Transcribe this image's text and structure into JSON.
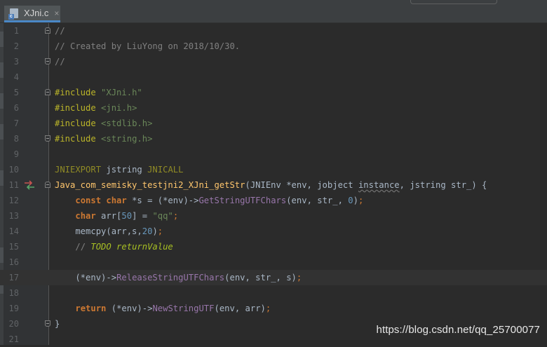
{
  "tab": {
    "filename": "XJni.c",
    "icon_letter": "c",
    "close_glyph": "×"
  },
  "lines": [
    {
      "num": "1",
      "tokens": [
        {
          "t": "cm",
          "v": "//"
        }
      ]
    },
    {
      "num": "2",
      "tokens": [
        {
          "t": "cm",
          "v": "// Created by LiuYong on 2018/10/30."
        }
      ]
    },
    {
      "num": "3",
      "tokens": [
        {
          "t": "cm",
          "v": "//"
        }
      ]
    },
    {
      "num": "4",
      "tokens": []
    },
    {
      "num": "5",
      "tokens": [
        {
          "t": "pp",
          "v": "#include "
        },
        {
          "t": "st",
          "v": "\"XJni.h\""
        }
      ]
    },
    {
      "num": "6",
      "tokens": [
        {
          "t": "pp",
          "v": "#include "
        },
        {
          "t": "st",
          "v": "<jni.h>"
        }
      ]
    },
    {
      "num": "7",
      "tokens": [
        {
          "t": "pp",
          "v": "#include "
        },
        {
          "t": "st",
          "v": "<stdlib.h>"
        }
      ]
    },
    {
      "num": "8",
      "tokens": [
        {
          "t": "pp",
          "v": "#include "
        },
        {
          "t": "st",
          "v": "<string.h>"
        }
      ]
    },
    {
      "num": "9",
      "tokens": []
    },
    {
      "num": "10",
      "tokens": [
        {
          "t": "mc",
          "v": "JNIEXPORT"
        },
        {
          "t": "pu",
          "v": " jstring "
        },
        {
          "t": "mc",
          "v": "JNICALL"
        }
      ]
    },
    {
      "num": "11",
      "tokens": [
        {
          "t": "fn",
          "v": "Java_com_semisky_testjni2_XJni_getStr"
        },
        {
          "t": "pu",
          "v": "(JNIEnv *env, jobject "
        },
        {
          "t": "un",
          "v": "instance"
        },
        {
          "t": "pu",
          "v": ", jstring str_) {"
        }
      ]
    },
    {
      "num": "12",
      "tokens": [
        {
          "t": "pu",
          "v": "    "
        },
        {
          "t": "ks",
          "v": "const char"
        },
        {
          "t": "pu",
          "v": " *s = (*env)->"
        },
        {
          "t": "mt",
          "v": "GetStringUTFChars"
        },
        {
          "t": "pu",
          "v": "(env, str_, "
        },
        {
          "t": "nb",
          "v": "0"
        },
        {
          "t": "pu",
          "v": ")"
        },
        {
          "t": "sc",
          "v": ";"
        }
      ]
    },
    {
      "num": "13",
      "tokens": [
        {
          "t": "pu",
          "v": "    "
        },
        {
          "t": "ks",
          "v": "char"
        },
        {
          "t": "pu",
          "v": " arr["
        },
        {
          "t": "nb",
          "v": "50"
        },
        {
          "t": "pu",
          "v": "] = "
        },
        {
          "t": "st",
          "v": "\"qq\""
        },
        {
          "t": "sc",
          "v": ";"
        }
      ]
    },
    {
      "num": "14",
      "tokens": [
        {
          "t": "pu",
          "v": "    memcpy(arr,s,"
        },
        {
          "t": "nb",
          "v": "20"
        },
        {
          "t": "pu",
          "v": ")"
        },
        {
          "t": "sc",
          "v": ";"
        }
      ]
    },
    {
      "num": "15",
      "tokens": [
        {
          "t": "pu",
          "v": "    "
        },
        {
          "t": "cm",
          "v": "// "
        },
        {
          "t": "td",
          "v": "TODO returnValue"
        }
      ]
    },
    {
      "num": "16",
      "tokens": []
    },
    {
      "num": "17",
      "tokens": [
        {
          "t": "pu",
          "v": "    (*env)->"
        },
        {
          "t": "mt",
          "v": "ReleaseStringUTFChars"
        },
        {
          "t": "pu",
          "v": "(env, str_, s)"
        },
        {
          "t": "sc",
          "v": ";"
        }
      ]
    },
    {
      "num": "18",
      "tokens": []
    },
    {
      "num": "19",
      "tokens": [
        {
          "t": "pu",
          "v": "    "
        },
        {
          "t": "ks",
          "v": "return"
        },
        {
          "t": "pu",
          "v": " (*env)->"
        },
        {
          "t": "mt",
          "v": "NewStringUTF"
        },
        {
          "t": "pu",
          "v": "(env, arr)"
        },
        {
          "t": "sc",
          "v": ";"
        }
      ]
    },
    {
      "num": "20",
      "tokens": [
        {
          "t": "pu",
          "v": "}"
        }
      ]
    },
    {
      "num": "21",
      "tokens": []
    }
  ],
  "current_line": "17",
  "watermark": "https://blog.csdn.net/qq_25700077",
  "colors": {
    "background": "#2b2b2b",
    "gutter": "#313335",
    "keyword": "#cc7832",
    "string": "#6a8759",
    "comment": "#808080",
    "function": "#ffc66d",
    "macro": "#908b25",
    "member": "#9876aa",
    "number": "#6897bb",
    "todo": "#a8c023"
  }
}
